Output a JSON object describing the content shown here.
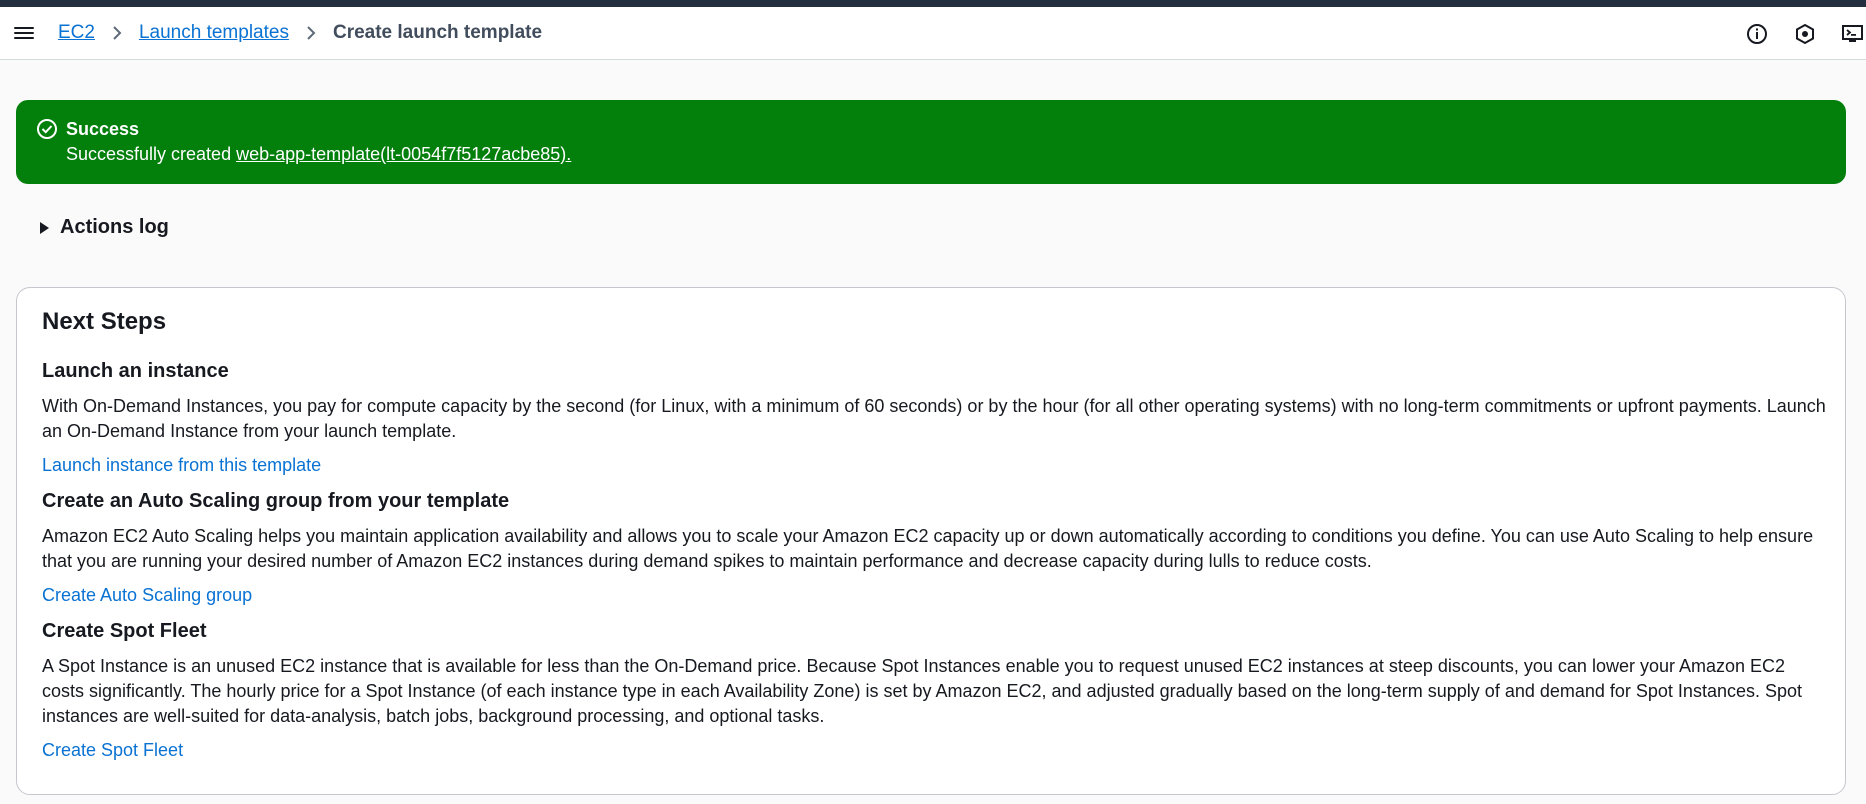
{
  "breadcrumb": {
    "items": [
      {
        "label": "EC2"
      },
      {
        "label": "Launch templates"
      }
    ],
    "current": "Create launch template"
  },
  "header": {
    "icons": [
      "menu-icon",
      "info-icon",
      "notifications-icon",
      "cloudshell-icon"
    ]
  },
  "flash": {
    "title": "Success",
    "message_prefix": "Successfully created ",
    "link_text": "web-app-template(lt-0054f7f5127acbe85).",
    "color": "#037f0c"
  },
  "actions_log": {
    "label": "Actions log"
  },
  "next_steps": {
    "title": "Next Steps",
    "sections": [
      {
        "title": "Launch an instance",
        "body": "With On-Demand Instances, you pay for compute capacity by the second (for Linux, with a minimum of 60 seconds) or by the hour (for all other operating systems) with no long-term commitments or upfront payments. Launch an On-Demand Instance from your launch template.",
        "link": "Launch instance from this template"
      },
      {
        "title": "Create an Auto Scaling group from your template",
        "body": "Amazon EC2 Auto Scaling helps you maintain application availability and allows you to scale your Amazon EC2 capacity up or down automatically according to conditions you define. You can use Auto Scaling to help ensure that you are running your desired number of Amazon EC2 instances during demand spikes to maintain performance and decrease capacity during lulls to reduce costs.",
        "link": "Create Auto Scaling group"
      },
      {
        "title": "Create Spot Fleet",
        "body": "A Spot Instance is an unused EC2 instance that is available for less than the On-Demand price. Because Spot Instances enable you to request unused EC2 instances at steep discounts, you can lower your Amazon EC2 costs significantly. The hourly price for a Spot Instance (of each instance type in each Availability Zone) is set by Amazon EC2, and adjusted gradually based on the long-term supply of and demand for Spot Instances. Spot instances are well-suited for data-analysis, batch jobs, background processing, and optional tasks.",
        "link": "Create Spot Fleet"
      }
    ]
  },
  "colors": {
    "link": "#0972d3",
    "text": "#16191f"
  }
}
